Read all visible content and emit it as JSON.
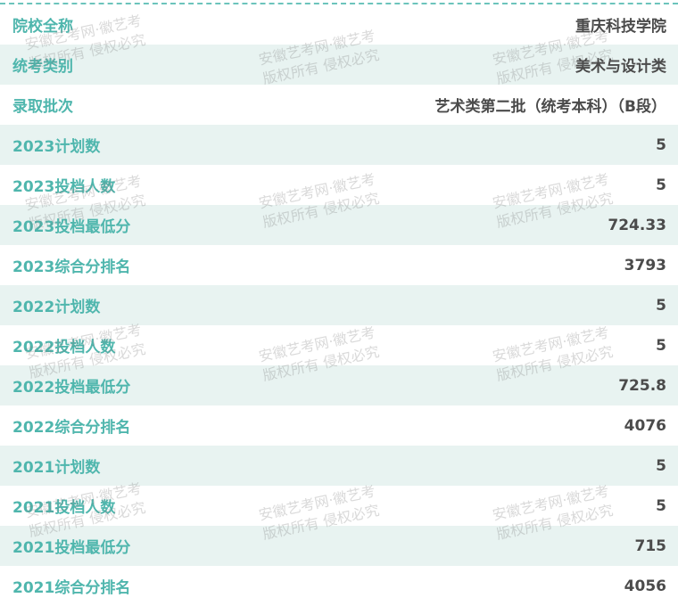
{
  "rows": [
    {
      "label": "院校全称",
      "value": "重庆科技学院"
    },
    {
      "label": "统考类别",
      "value": "美术与设计类"
    },
    {
      "label": "录取批次",
      "value": "艺术类第二批（统考本科）（B段）"
    },
    {
      "label": "2023计划数",
      "value": "5"
    },
    {
      "label": "2023投档人数",
      "value": "5"
    },
    {
      "label": "2023投档最低分",
      "value": "724.33"
    },
    {
      "label": "2023综合分排名",
      "value": "3793"
    },
    {
      "label": "2022计划数",
      "value": "5"
    },
    {
      "label": "2022投档人数",
      "value": "5"
    },
    {
      "label": "2022投档最低分",
      "value": "725.8"
    },
    {
      "label": "2022综合分排名",
      "value": "4076"
    },
    {
      "label": "2021计划数",
      "value": "5"
    },
    {
      "label": "2021投档人数",
      "value": "5"
    },
    {
      "label": "2021投档最低分",
      "value": "715"
    },
    {
      "label": "2021综合分排名",
      "value": "4056"
    }
  ],
  "watermark": {
    "line1": "安徽艺考网·徽艺考",
    "line2": "版权所有 侵权必究"
  }
}
